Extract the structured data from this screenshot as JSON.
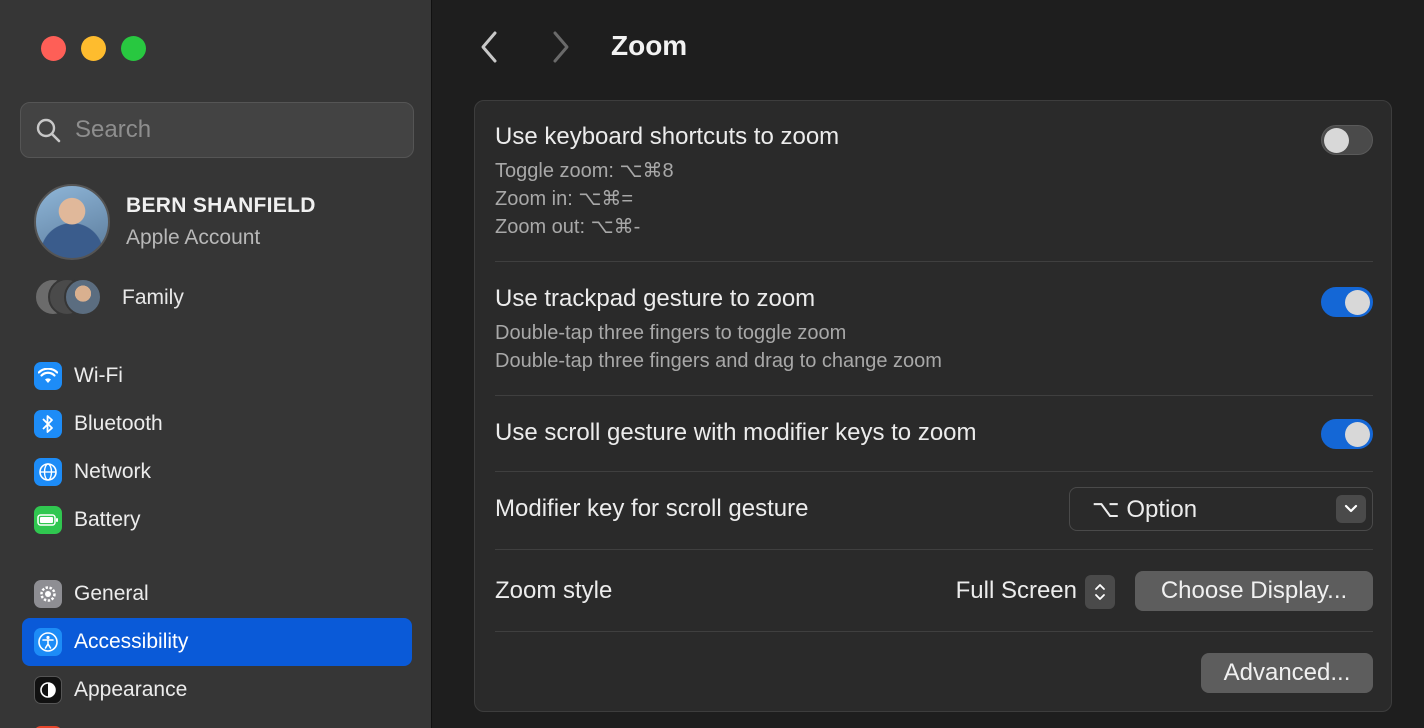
{
  "sidebar": {
    "search": {
      "placeholder": "Search"
    },
    "account": {
      "name": "BERN SHANFIELD",
      "subtitle": "Apple Account"
    },
    "family": {
      "label": "Family"
    },
    "group1": [
      {
        "label": "Wi-Fi",
        "icon": "wifi-icon"
      },
      {
        "label": "Bluetooth",
        "icon": "bluetooth-icon"
      },
      {
        "label": "Network",
        "icon": "globe-icon"
      },
      {
        "label": "Battery",
        "icon": "battery-icon"
      }
    ],
    "group2": [
      {
        "label": "General",
        "icon": "gear-icon"
      },
      {
        "label": "Accessibility",
        "icon": "accessibility-icon",
        "active": true
      },
      {
        "label": "Appearance",
        "icon": "appearance-icon"
      }
    ]
  },
  "main": {
    "title": "Zoom",
    "keyboard": {
      "title": "Use keyboard shortcuts to zoom",
      "lines": [
        "Toggle zoom: ⌥⌘8",
        "Zoom in: ⌥⌘=",
        "Zoom out: ⌥⌘-"
      ],
      "enabled": false
    },
    "trackpad": {
      "title": "Use trackpad gesture to zoom",
      "lines": [
        "Double-tap three fingers to toggle zoom",
        "Double-tap three fingers and drag to change zoom"
      ],
      "enabled": true
    },
    "scroll": {
      "title": "Use scroll gesture with modifier keys to zoom",
      "enabled": true
    },
    "modifier": {
      "label": "Modifier key for scroll gesture",
      "value": "⌥ Option"
    },
    "zoom_style": {
      "label": "Zoom style",
      "value": "Full Screen",
      "choose_label": "Choose Display..."
    },
    "advanced_label": "Advanced..."
  },
  "colors": {
    "accent": "#0a5ad8",
    "toggle_on": "#1467d6"
  }
}
